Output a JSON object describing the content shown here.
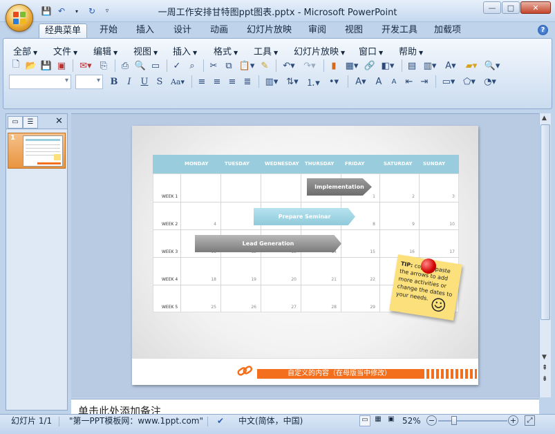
{
  "window": {
    "title": "一周工作安排甘特图ppt图表.pptx - Microsoft PowerPoint"
  },
  "ribbon_tabs": [
    "经典菜单",
    "开始",
    "插入",
    "设计",
    "动画",
    "幻灯片放映",
    "审阅",
    "视图",
    "开发工具",
    "加载项"
  ],
  "classic_menu": [
    "全部",
    "文件",
    "编辑",
    "视图",
    "插入",
    "格式",
    "工具",
    "幻灯片放映",
    "窗口",
    "帮助"
  ],
  "panel": {
    "thumb_number": "1"
  },
  "slide": {
    "days": [
      "MONDAY",
      "TUESDAY",
      "WEDNESDAY",
      "THURSDAY",
      "FRIDAY",
      "SATURDAY",
      "SUNDAY"
    ],
    "weeks": [
      "WEEK 1",
      "WEEK 2",
      "WEEK 3",
      "WEEK 4",
      "WEEK 5"
    ],
    "dates": [
      [
        "",
        "",
        "",
        "",
        "1",
        "2",
        "3"
      ],
      [
        "4",
        "5",
        "6",
        "7",
        "8",
        "9",
        "10"
      ],
      [
        "11",
        "12",
        "13",
        "14",
        "15",
        "16",
        "17"
      ],
      [
        "18",
        "19",
        "20",
        "21",
        "22",
        "",
        ""
      ],
      [
        "25",
        "26",
        "27",
        "28",
        "29",
        "",
        ""
      ]
    ],
    "bars": {
      "implementation": "Implementation",
      "prepare_seminar": "Prepare Seminar",
      "lead_generation": "Lead Generation"
    },
    "tip": {
      "label": "TIP:",
      "text": "copy & paste the arrows to add more activities or change the dates to your needs."
    },
    "footer_text": "自定义的内容（在母版当中修改）"
  },
  "notes_placeholder": "单击此处添加备注",
  "status": {
    "slide_indicator": "幻灯片 1/1",
    "theme_name": "\"第一PPT模板网：www.1ppt.com\"",
    "language": "中文(简体，中国)",
    "zoom": "52%"
  },
  "colors": {
    "day_header": "#99cddd",
    "footer_accent": "#f36f1d",
    "sticky_note": "#fbe07b"
  }
}
